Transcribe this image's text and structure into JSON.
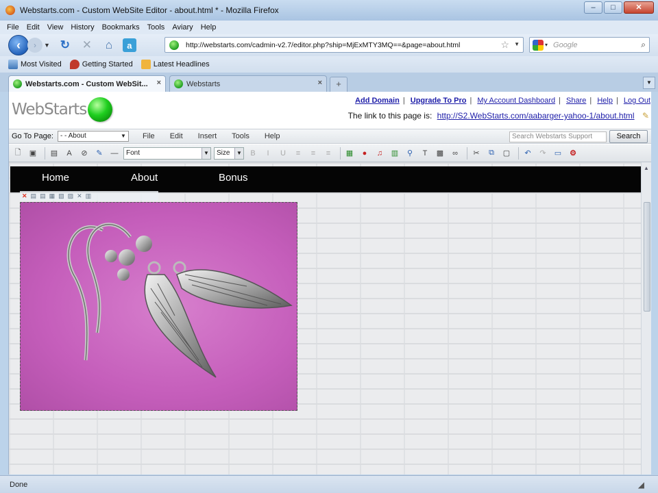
{
  "window": {
    "title": "Webstarts.com - Custom WebSite Editor - about.html * - Mozilla Firefox",
    "controls": [
      "–",
      "□",
      "✕"
    ]
  },
  "menubar": [
    "File",
    "Edit",
    "View",
    "History",
    "Bookmarks",
    "Tools",
    "Aviary",
    "Help"
  ],
  "navbar": {
    "url": "http://webstarts.com/cadmin-v2.7/editor.php?ship=MjExMTY3MQ==&page=about.html",
    "search_placeholder": "Google"
  },
  "bookmarks": [
    "Most Visited",
    "Getting Started",
    "Latest Headlines"
  ],
  "tabs": [
    {
      "label": "Webstarts.com - Custom WebSit...",
      "active": true
    },
    {
      "label": "Webstarts",
      "active": false
    }
  ],
  "webstarts": {
    "logo_text": "WebStarts",
    "top_links": [
      "Add Domain",
      "Upgrade To Pro",
      "My Account Dashboard",
      "Share",
      "Help",
      "Log Out"
    ],
    "page_link_label": "The link to this page is:",
    "page_link_url": "http://S2.WebStarts.com/aabarger-yahoo-1/about.html",
    "goto_label": "Go To Page:",
    "goto_value": "- - About",
    "menu": [
      "File",
      "Edit",
      "Insert",
      "Tools",
      "Help"
    ],
    "search_placeholder": "Search Webstarts Support",
    "search_button": "Search",
    "font_select": "Font",
    "size_select": "Size"
  },
  "site_nav": [
    "Home",
    "About",
    "Bonus"
  ],
  "status": "Done",
  "colors": {
    "site_nav_bg": "#050505",
    "photo_bg": "#c55ebb",
    "link": "#1c1ca8"
  }
}
